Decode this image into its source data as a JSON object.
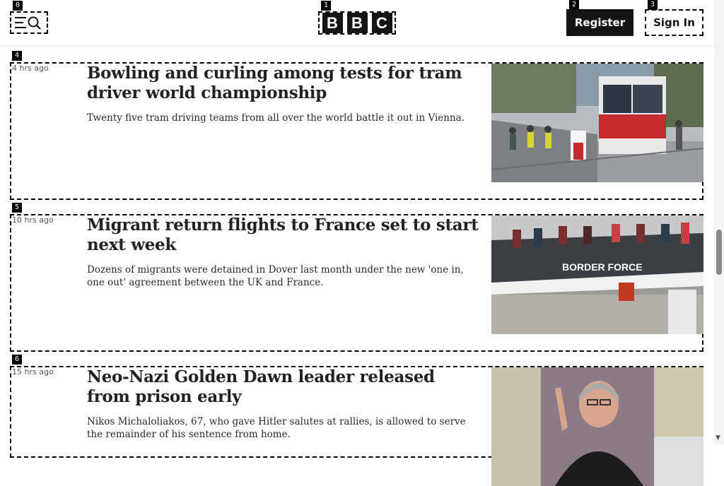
{
  "markers": [
    "0",
    "1",
    "2",
    "3",
    "4",
    "5",
    "6"
  ],
  "header": {
    "logo": [
      "B",
      "B",
      "C"
    ],
    "register_label": "Register",
    "signin_label": "Sign In"
  },
  "stories": [
    {
      "time": "4 hrs ago",
      "headline": "Bowling and curling among tests for tram driver world championship",
      "summary": "Twenty five tram driving teams from all over the world battle it out in Vienna.",
      "image_text": ""
    },
    {
      "time": "10 hrs ago",
      "headline": "Migrant return flights to France set to start next week",
      "summary": "Dozens of migrants were detained in Dover last month under the new 'one in, one out' agreement between the UK and France.",
      "image_text": "BORDER FORCE"
    },
    {
      "time": "15 hrs ago",
      "headline": "Neo-Nazi Golden Dawn leader released from prison early",
      "summary": "Nikos Michaloliakos, 67, who gave Hitler salutes at rallies, is allowed to serve the remainder of his sentence from home.",
      "image_text": ""
    }
  ]
}
